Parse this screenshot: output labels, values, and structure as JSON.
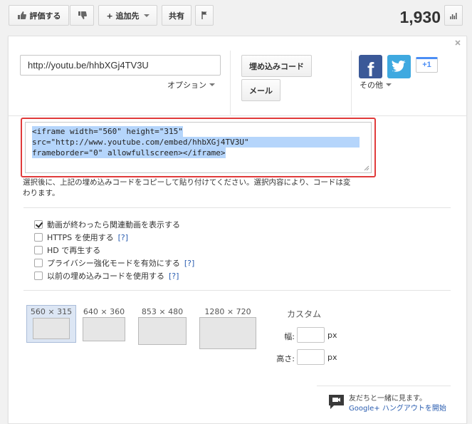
{
  "toolbar": {
    "like_label": "評価する",
    "add_to_label": "+ 追加先",
    "share_label": "共有",
    "view_count": "1,930"
  },
  "share": {
    "url_value": "http://youtu.be/hhbXGj4TV3U",
    "options_label": "オプション",
    "embed_code_label": "埋め込みコード",
    "email_label": "メール",
    "more_label": "その他",
    "gplus_label": "+1"
  },
  "embed": {
    "code_lines": [
      "<iframe width=\"560\" height=\"315\"",
      "src=\"http://www.youtube.com/embed/hhbXGj4TV3U\"",
      "frameborder=\"0\" allowfullscreen></iframe>"
    ],
    "note": "選択後に、上記の埋め込みコードをコピーして貼り付けてください。選択内容により、コードは変わります。"
  },
  "options": [
    {
      "label": "動画が終わったら関連動画を表示する",
      "checked": true,
      "help": ""
    },
    {
      "label": "HTTPS を使用する",
      "checked": false,
      "help": "[?]"
    },
    {
      "label": "HD で再生する",
      "checked": false,
      "help": ""
    },
    {
      "label": "プライバシー強化モードを有効にする",
      "checked": false,
      "help": "[?]"
    },
    {
      "label": "以前の埋め込みコードを使用する",
      "checked": false,
      "help": "[?]"
    }
  ],
  "sizes": {
    "items": [
      "560 × 315",
      "640 × 360",
      "853 × 480",
      "1280 × 720"
    ],
    "selected": "560 × 315",
    "custom_label": "カスタム",
    "width_label": "幅:",
    "height_label": "高さ:",
    "unit": "px"
  },
  "hangout": {
    "line1": "友だちと一緒に見ます。",
    "line2": "Google+ ハングアウトを開始"
  },
  "colors": {
    "highlight": "#b5d5fb",
    "focus_border": "#e03b3b",
    "link": "#2a5db0",
    "facebook": "#3b5998",
    "twitter": "#3fa9e0"
  }
}
